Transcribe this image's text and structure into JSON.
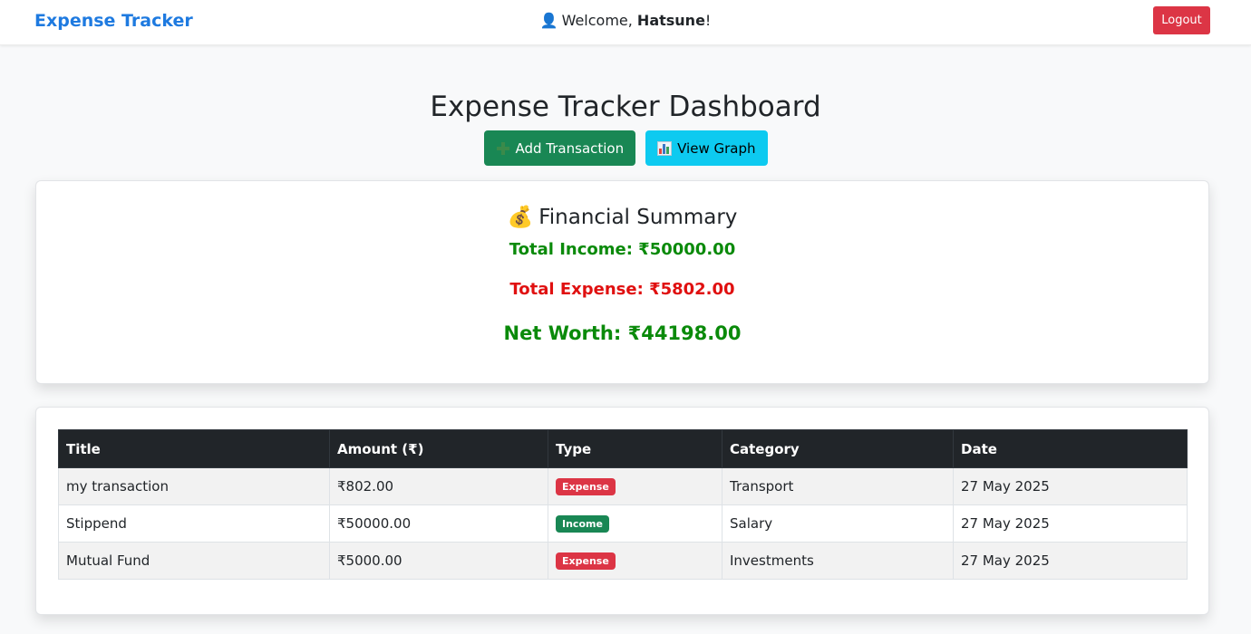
{
  "navbar": {
    "brand": "Expense Tracker",
    "welcome_prefix": "Welcome, ",
    "username": "Hatsune",
    "welcome_suffix": "!",
    "logout_label": "Logout"
  },
  "dashboard": {
    "title": "Expense Tracker Dashboard",
    "add_transaction_label": "Add Transaction",
    "view_graph_label": "View Graph"
  },
  "summary": {
    "title": "Financial Summary",
    "total_income": "Total Income: ₹50000.00",
    "total_expense": "Total Expense: ₹5802.00",
    "net_worth": "Net Worth: ₹44198.00"
  },
  "table": {
    "headers": [
      "Title",
      "Amount (₹)",
      "Type",
      "Category",
      "Date"
    ],
    "rows": [
      {
        "title": "my transaction",
        "amount": "₹802.00",
        "type": "Expense",
        "category": "Transport",
        "date": "27 May 2025"
      },
      {
        "title": "Stippend",
        "amount": "₹50000.00",
        "type": "Income",
        "category": "Salary",
        "date": "27 May 2025"
      },
      {
        "title": "Mutual Fund",
        "amount": "₹5000.00",
        "type": "Expense",
        "category": "Investments",
        "date": "27 May 2025"
      }
    ]
  },
  "colors": {
    "brand": "#1e7ae0",
    "logout": "#dc3545",
    "add_button": "#198754",
    "graph_button": "#0dcaf0",
    "income_text": "#0a8a0a",
    "expense_text": "#e01010",
    "badge_expense": "#dc3545",
    "badge_income": "#198754",
    "table_header": "#212529"
  },
  "icons": {
    "welcome": "user-icon",
    "add": "plus-icon",
    "graph": "bar-chart-icon",
    "summary": "money-bag-icon"
  }
}
